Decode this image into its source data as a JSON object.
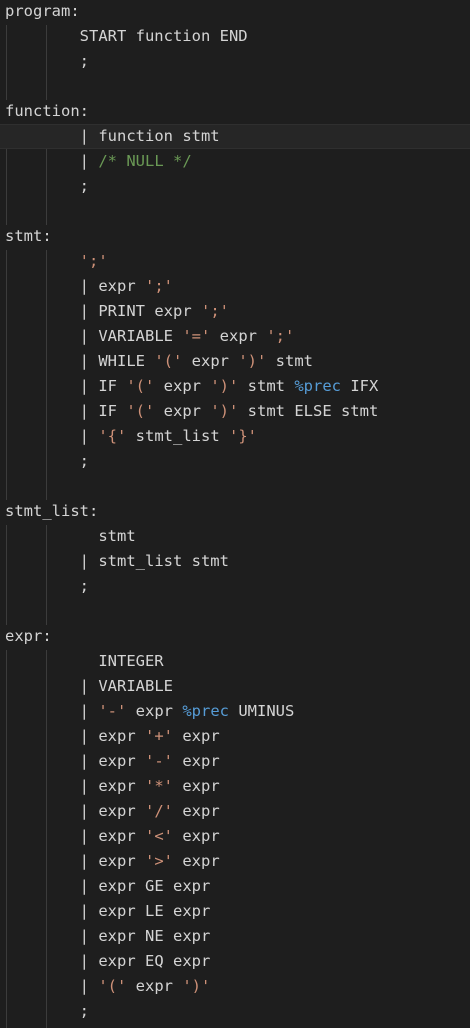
{
  "colors": {
    "background": "#1e1e1e",
    "text": "#d4d4d4",
    "string": "#ce9178",
    "comment": "#6a9955",
    "keyword": "#569cd6",
    "indent_guide": "#3c3c3c"
  },
  "lines": [
    {
      "segments": [
        {
          "t": "program:",
          "c": "default"
        }
      ]
    },
    {
      "segments": [
        {
          "t": "        START function END",
          "c": "default"
        }
      ]
    },
    {
      "segments": [
        {
          "t": "        ;",
          "c": "default"
        }
      ]
    },
    {
      "segments": []
    },
    {
      "segments": [
        {
          "t": "function:",
          "c": "default"
        }
      ]
    },
    {
      "segments": [
        {
          "t": "        | ",
          "c": "bar"
        },
        {
          "t": "function stmt",
          "c": "default"
        }
      ],
      "active": true
    },
    {
      "segments": [
        {
          "t": "        | ",
          "c": "bar"
        },
        {
          "t": "/* NULL */",
          "c": "comment"
        }
      ]
    },
    {
      "segments": [
        {
          "t": "        ;",
          "c": "default"
        }
      ]
    },
    {
      "segments": []
    },
    {
      "segments": [
        {
          "t": "stmt:",
          "c": "default"
        }
      ]
    },
    {
      "segments": [
        {
          "t": "        ",
          "c": "default"
        },
        {
          "t": "';'",
          "c": "string"
        }
      ]
    },
    {
      "segments": [
        {
          "t": "        | ",
          "c": "bar"
        },
        {
          "t": "expr ",
          "c": "default"
        },
        {
          "t": "';'",
          "c": "string"
        }
      ]
    },
    {
      "segments": [
        {
          "t": "        | ",
          "c": "bar"
        },
        {
          "t": "PRINT expr ",
          "c": "default"
        },
        {
          "t": "';'",
          "c": "string"
        }
      ]
    },
    {
      "segments": [
        {
          "t": "        | ",
          "c": "bar"
        },
        {
          "t": "VARIABLE ",
          "c": "default"
        },
        {
          "t": "'='",
          "c": "string"
        },
        {
          "t": " expr ",
          "c": "default"
        },
        {
          "t": "';'",
          "c": "string"
        }
      ]
    },
    {
      "segments": [
        {
          "t": "        | ",
          "c": "bar"
        },
        {
          "t": "WHILE ",
          "c": "default"
        },
        {
          "t": "'('",
          "c": "string"
        },
        {
          "t": " expr ",
          "c": "default"
        },
        {
          "t": "')'",
          "c": "string"
        },
        {
          "t": " stmt",
          "c": "default"
        }
      ]
    },
    {
      "segments": [
        {
          "t": "        | ",
          "c": "bar"
        },
        {
          "t": "IF ",
          "c": "default"
        },
        {
          "t": "'('",
          "c": "string"
        },
        {
          "t": " expr ",
          "c": "default"
        },
        {
          "t": "')'",
          "c": "string"
        },
        {
          "t": " stmt ",
          "c": "default"
        },
        {
          "t": "%prec",
          "c": "keyword"
        },
        {
          "t": " IFX",
          "c": "default"
        }
      ]
    },
    {
      "segments": [
        {
          "t": "        | ",
          "c": "bar"
        },
        {
          "t": "IF ",
          "c": "default"
        },
        {
          "t": "'('",
          "c": "string"
        },
        {
          "t": " expr ",
          "c": "default"
        },
        {
          "t": "')'",
          "c": "string"
        },
        {
          "t": " stmt ELSE stmt",
          "c": "default"
        }
      ]
    },
    {
      "segments": [
        {
          "t": "        | ",
          "c": "bar"
        },
        {
          "t": "'{'",
          "c": "string"
        },
        {
          "t": " stmt_list ",
          "c": "default"
        },
        {
          "t": "'}'",
          "c": "string"
        }
      ]
    },
    {
      "segments": [
        {
          "t": "        ;",
          "c": "default"
        }
      ]
    },
    {
      "segments": []
    },
    {
      "segments": [
        {
          "t": "stmt_list:",
          "c": "default"
        }
      ]
    },
    {
      "segments": [
        {
          "t": "          stmt",
          "c": "default"
        }
      ]
    },
    {
      "segments": [
        {
          "t": "        | ",
          "c": "bar"
        },
        {
          "t": "stmt_list stmt",
          "c": "default"
        }
      ]
    },
    {
      "segments": [
        {
          "t": "        ;",
          "c": "default"
        }
      ]
    },
    {
      "segments": []
    },
    {
      "segments": [
        {
          "t": "expr:",
          "c": "default"
        }
      ]
    },
    {
      "segments": [
        {
          "t": "          INTEGER",
          "c": "default"
        }
      ]
    },
    {
      "segments": [
        {
          "t": "        | ",
          "c": "bar"
        },
        {
          "t": "VARIABLE",
          "c": "default"
        }
      ]
    },
    {
      "segments": [
        {
          "t": "        | ",
          "c": "bar"
        },
        {
          "t": "'-'",
          "c": "string"
        },
        {
          "t": " expr ",
          "c": "default"
        },
        {
          "t": "%prec",
          "c": "keyword"
        },
        {
          "t": " UMINUS",
          "c": "default"
        }
      ]
    },
    {
      "segments": [
        {
          "t": "        | ",
          "c": "bar"
        },
        {
          "t": "expr ",
          "c": "default"
        },
        {
          "t": "'+'",
          "c": "string"
        },
        {
          "t": " expr",
          "c": "default"
        }
      ]
    },
    {
      "segments": [
        {
          "t": "        | ",
          "c": "bar"
        },
        {
          "t": "expr ",
          "c": "default"
        },
        {
          "t": "'-'",
          "c": "string"
        },
        {
          "t": " expr",
          "c": "default"
        }
      ]
    },
    {
      "segments": [
        {
          "t": "        | ",
          "c": "bar"
        },
        {
          "t": "expr ",
          "c": "default"
        },
        {
          "t": "'*'",
          "c": "string"
        },
        {
          "t": " expr",
          "c": "default"
        }
      ]
    },
    {
      "segments": [
        {
          "t": "        | ",
          "c": "bar"
        },
        {
          "t": "expr ",
          "c": "default"
        },
        {
          "t": "'/'",
          "c": "string"
        },
        {
          "t": " expr",
          "c": "default"
        }
      ]
    },
    {
      "segments": [
        {
          "t": "        | ",
          "c": "bar"
        },
        {
          "t": "expr ",
          "c": "default"
        },
        {
          "t": "'<'",
          "c": "string"
        },
        {
          "t": " expr",
          "c": "default"
        }
      ]
    },
    {
      "segments": [
        {
          "t": "        | ",
          "c": "bar"
        },
        {
          "t": "expr ",
          "c": "default"
        },
        {
          "t": "'>'",
          "c": "string"
        },
        {
          "t": " expr",
          "c": "default"
        }
      ]
    },
    {
      "segments": [
        {
          "t": "        | ",
          "c": "bar"
        },
        {
          "t": "expr GE expr",
          "c": "default"
        }
      ]
    },
    {
      "segments": [
        {
          "t": "        | ",
          "c": "bar"
        },
        {
          "t": "expr LE expr",
          "c": "default"
        }
      ]
    },
    {
      "segments": [
        {
          "t": "        | ",
          "c": "bar"
        },
        {
          "t": "expr NE expr",
          "c": "default"
        }
      ]
    },
    {
      "segments": [
        {
          "t": "        | ",
          "c": "bar"
        },
        {
          "t": "expr EQ expr",
          "c": "default"
        }
      ]
    },
    {
      "segments": [
        {
          "t": "        | ",
          "c": "bar"
        },
        {
          "t": "'('",
          "c": "string"
        },
        {
          "t": " expr ",
          "c": "default"
        },
        {
          "t": "')'",
          "c": "string"
        }
      ]
    },
    {
      "segments": [
        {
          "t": "        ;",
          "c": "default"
        }
      ]
    }
  ]
}
